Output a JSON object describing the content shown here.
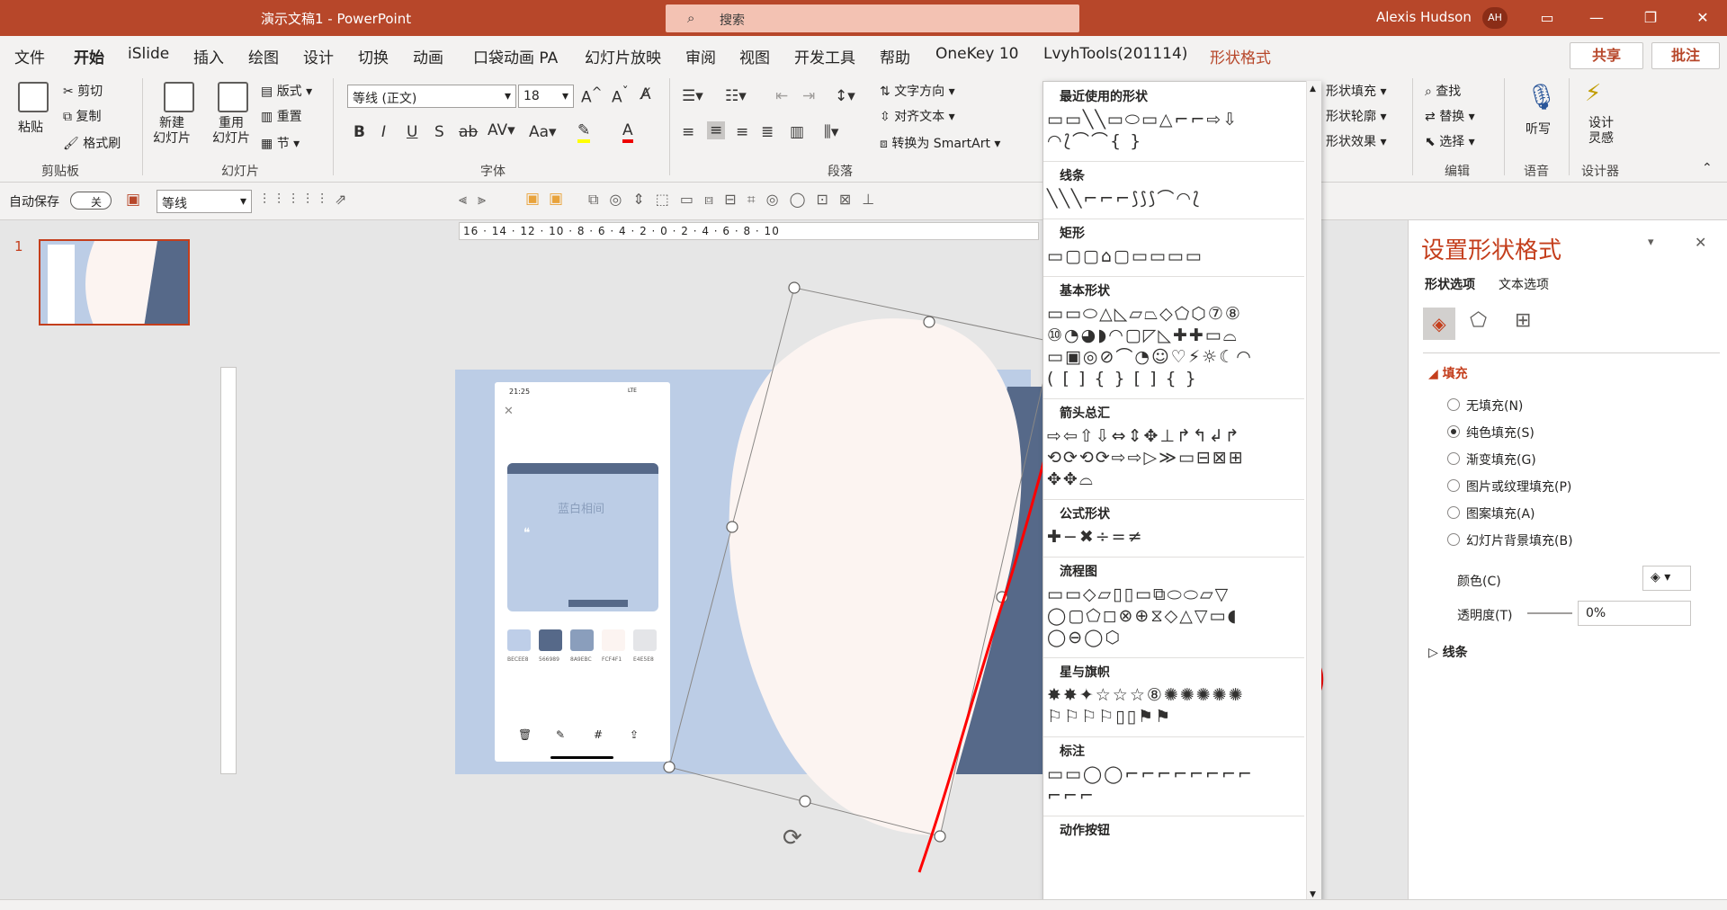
{
  "titlebar": {
    "doc_title": "演示文稿1  -  PowerPoint",
    "search_placeholder": "搜索",
    "user_name": "Alexis Hudson",
    "user_initials": "AH"
  },
  "tabs": [
    "文件",
    "开始",
    "iSlide",
    "插入",
    "绘图",
    "设计",
    "切换",
    "动画",
    "口袋动画 PA",
    "幻灯片放映",
    "审阅",
    "视图",
    "开发工具",
    "帮助",
    "OneKey 10",
    "LvyhTools(201114)",
    "形状格式"
  ],
  "actions": {
    "share": "共享",
    "comment": "批注"
  },
  "ribbon": {
    "clipboard": {
      "paste": "粘贴",
      "cut": "剪切",
      "copy": "复制",
      "format_painter": "格式刷",
      "group": "剪贴板"
    },
    "slides": {
      "new_slide": "新建\n幻灯片",
      "reuse": "重用\n幻灯片",
      "layout": "版式",
      "reset": "重置",
      "section": "节",
      "group": "幻灯片"
    },
    "font": {
      "font_name": "等线 (正文)",
      "font_size": "18",
      "group": "字体"
    },
    "paragraph": {
      "text_direction": "文字方向",
      "align_text": "对齐文本",
      "smartart": "转换为 SmartArt",
      "group": "段落"
    },
    "drawing": {
      "shape_fill": "形状填充",
      "shape_outline": "形状轮廓",
      "shape_effects": "形状效果"
    },
    "editing": {
      "find": "查找",
      "replace": "替换",
      "select": "选择",
      "group": "编辑"
    },
    "voice": {
      "dictate": "听写",
      "group": "语音"
    },
    "designer": {
      "design_ideas": "设计\n灵感",
      "group": "设计器"
    }
  },
  "qat": {
    "autosave": "自动保存",
    "toggle": "关",
    "font": "等线"
  },
  "slide_panel": {
    "slide_number": "1"
  },
  "ruler": {
    "labels": "16 · 14 · 12 · 10 · 8 · 6 · 4 · 2 · 0 · 2 · 4 · 6 · 8 · 10"
  },
  "phone": {
    "time": "21:25",
    "network": "LTE",
    "card_title": "蓝白相间",
    "swatches": [
      {
        "hex": "BECEE8",
        "color": "#BECEE8"
      },
      {
        "hex": "566989",
        "color": "#566989"
      },
      {
        "hex": "8A9EBC",
        "color": "#8A9EBC"
      },
      {
        "hex": "FCF4F1",
        "color": "#FCF4F1"
      },
      {
        "hex": "E4E5E8",
        "color": "#E4E5E8"
      }
    ]
  },
  "gallery": {
    "sections": [
      {
        "title": "最近使用的形状",
        "rows": [
          "▭▭╲╲▭⬭▭△⌐⌐⇨⇩",
          "◠⟅⌒⌒{ }"
        ]
      },
      {
        "title": "线条",
        "rows": [
          "╲╲╲⌐⌐⌐⟆⟆⟆⌒◠⟅"
        ]
      },
      {
        "title": "矩形",
        "rows": [
          "▭▢▢⌂▢▭▭▭▭"
        ]
      },
      {
        "title": "基本形状",
        "rows": [
          "▭▭⬭△◺▱⏢◇⬠⬡⑦⑧",
          "⑩◔◕◗◠▢◸◺✚✚▭⌓",
          "▭▣◎⊘⌒◔☺♡⚡☼☾◠",
          "( [ ] { } [ ] { }"
        ]
      },
      {
        "title": "箭头总汇",
        "rows": [
          "⇨⇦⇧⇩⇔⇕✥⊥↱↰↲↱",
          "⟲⟳⟲⟳⇨⇨▷≫▭⊟⊠⊞",
          "✥✥⌓"
        ]
      },
      {
        "title": "公式形状",
        "rows": [
          "✚−✖÷=≠"
        ]
      },
      {
        "title": "流程图",
        "rows": [
          "▭▭◇▱▯▯▭⧉⬭⬭⏥▽",
          "◯▢⬠◻⊗⊕⧖◇△▽▭◖",
          "◯⊖◯⬡"
        ]
      },
      {
        "title": "星与旗帜",
        "rows": [
          "✸✸✦☆☆☆⑧✺✺✺✺✺",
          "⚐⚐⚐⚐▯▯⚑⚑"
        ]
      },
      {
        "title": "标注",
        "rows": [
          "▭▭◯◯⌐⌐⌐⌐⌐⌐⌐⌐",
          "⌐⌐⌐"
        ]
      },
      {
        "title": "动作按钮",
        "rows": []
      }
    ]
  },
  "format_pane": {
    "title": "设置形状格式",
    "tab_shape": "形状选项",
    "tab_text": "文本选项",
    "fill_header": "填充",
    "options": [
      "无填充(N)",
      "纯色填充(S)",
      "渐变填充(G)",
      "图片或纹理填充(P)",
      "图案填充(A)",
      "幻灯片背景填充(B)"
    ],
    "selected_option": 1,
    "color_label": "颜色(C)",
    "transparency_label": "透明度(T)",
    "transparency_value": "0%",
    "line_header": "线条"
  },
  "colors": {
    "accent": "#b7472a",
    "slide_bg": "#bccde6",
    "dark_blue": "#566989",
    "shape_fill": "#fcf4f1",
    "annotation": "#ff0000"
  }
}
